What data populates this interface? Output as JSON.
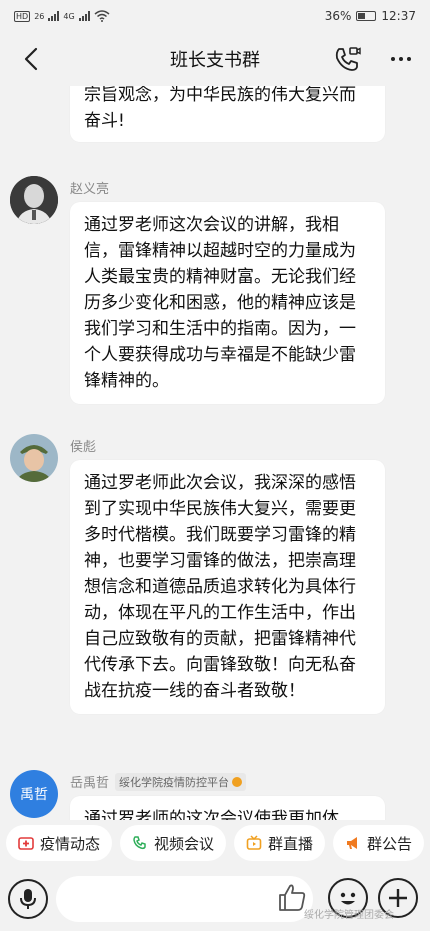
{
  "status_bar": {
    "network_left": "HD",
    "net_1": "26",
    "net_2": "4G",
    "battery_pct": "36%",
    "time": "12:37"
  },
  "nav": {
    "title": "班长支书群"
  },
  "messages": [
    {
      "sender": "",
      "text": "宗旨观念，为中华民族的伟大复兴而奋斗!"
    },
    {
      "sender": "赵义亮",
      "text": "通过罗老师这次会议的讲解，我相信，雷锋精神以超越时空的力量成为人类最宝贵的精神财富。无论我们经历多少变化和困惑，他的精神应该是我们学习和生活中的指南。因为，一个人要获得成功与幸福是不能缺少雷锋精神的。"
    },
    {
      "sender": "侯彪",
      "text": "通过罗老师此次会议，我深深的感悟到了实现中华民族伟大复兴，需要更多时代楷模。我们既要学习雷锋的精神，也要学习雷锋的做法，把崇高理想信念和道德品质追求转化为具体行动，体现在平凡的工作生活中，作出自己应致敬有的贡献，把雷锋精神代代传承下去。向雷锋致敬！向无私奋战在抗疫一线的奋斗者致敬！"
    },
    {
      "sender": "岳禹哲",
      "avatar_text": "禹哲",
      "tag": "绥化学院疫情防控平台",
      "text": "通过罗老师的这次会议使我更加体"
    }
  ],
  "quick_actions": [
    {
      "label": "疫情动态",
      "icon": "plus-cross-icon"
    },
    {
      "label": "视频会议",
      "icon": "video-phone-icon"
    },
    {
      "label": "群直播",
      "icon": "live-tv-icon"
    },
    {
      "label": "群公告",
      "icon": "megaphone-icon"
    }
  ],
  "watermark": "绥化学院管理团委会",
  "colors": {
    "accent_blue": "#2f7fe0",
    "background": "#f2f2f2",
    "bubble": "#ffffff"
  }
}
